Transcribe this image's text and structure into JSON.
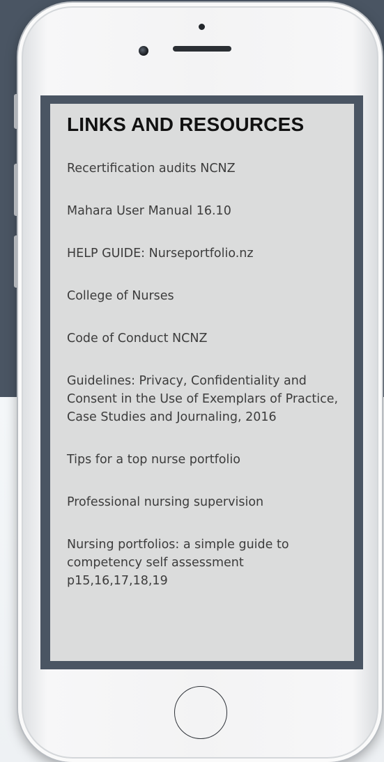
{
  "section": {
    "title": "LINKS AND RESOURCES"
  },
  "links": [
    {
      "label": "Recertification audits NCNZ"
    },
    {
      "label": "Mahara User Manual 16.10"
    },
    {
      "label": "HELP GUIDE: Nurseportfolio.nz"
    },
    {
      "label": "College of Nurses"
    },
    {
      "label": "Code of Conduct NCNZ"
    },
    {
      "label": "Guidelines: Privacy, Confidentiality and Consent in the Use of Exemplars of Practice, Case Studies and Journaling, 2016"
    },
    {
      "label": "Tips for a top nurse portfolio"
    },
    {
      "label": "Professional nursing supervision"
    },
    {
      "label": "Nursing portfolios: a simple guide to competency self assessment p15,16,17,18,19"
    }
  ],
  "colors": {
    "page_dark": "#4a5563",
    "screen_bg": "#dbdcdc",
    "link_text": "#3c3c3c",
    "title_text": "#111111"
  }
}
